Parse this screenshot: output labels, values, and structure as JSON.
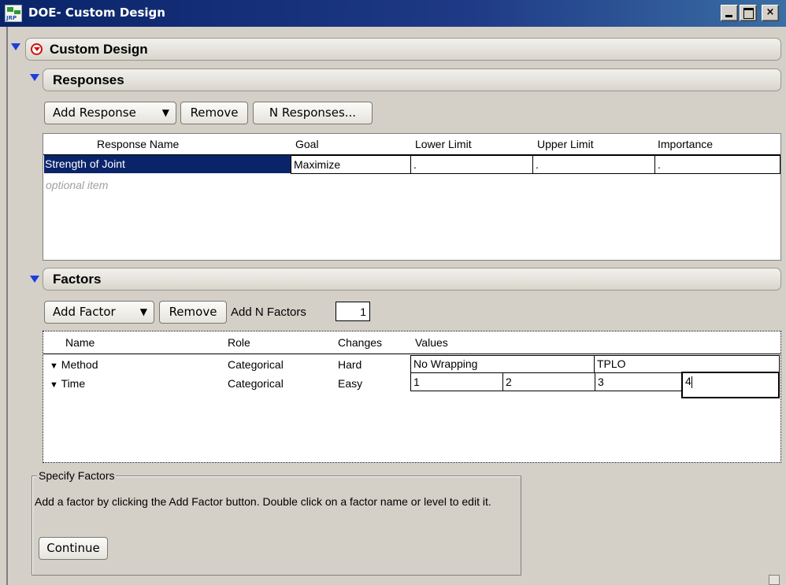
{
  "window": {
    "title": "DOE- Custom Design",
    "controls": {
      "minimize": "",
      "maximize": "",
      "close": "×"
    }
  },
  "custom_design": {
    "title": "Custom Design"
  },
  "responses": {
    "title": "Responses",
    "buttons": {
      "add_response": "Add Response",
      "remove": "Remove",
      "n_responses": "N Responses..."
    },
    "columns": [
      "Response Name",
      "Goal",
      "Lower Limit",
      "Upper Limit",
      "Importance"
    ],
    "rows": [
      {
        "name": "Strength of Joint",
        "goal": "Maximize",
        "lower": ".",
        "upper": ".",
        "importance": "."
      }
    ],
    "optional_placeholder": "optional item"
  },
  "factors": {
    "title": "Factors",
    "buttons": {
      "add_factor": "Add Factor",
      "remove": "Remove",
      "add_n_label": "Add N Factors"
    },
    "add_n_value": "1",
    "columns": [
      "Name",
      "Role",
      "Changes",
      "Values"
    ],
    "rows": [
      {
        "name": "Method",
        "role": "Categorical",
        "changes": "Hard",
        "values": [
          "No Wrapping",
          "TPLO"
        ]
      },
      {
        "name": "Time",
        "role": "Categorical",
        "changes": "Easy",
        "values": [
          "1",
          "2",
          "3",
          "4"
        ]
      }
    ]
  },
  "specify": {
    "legend": "Specify Factors",
    "text": "Add a factor by clicking the Add Factor button. Double click on a factor name or level to edit it.",
    "continue": "Continue"
  },
  "colors": {
    "selection": "#0a246a",
    "titlebar": "#0a246a",
    "disclosure": "#1a3ee0",
    "menu_red": "#d01010"
  }
}
